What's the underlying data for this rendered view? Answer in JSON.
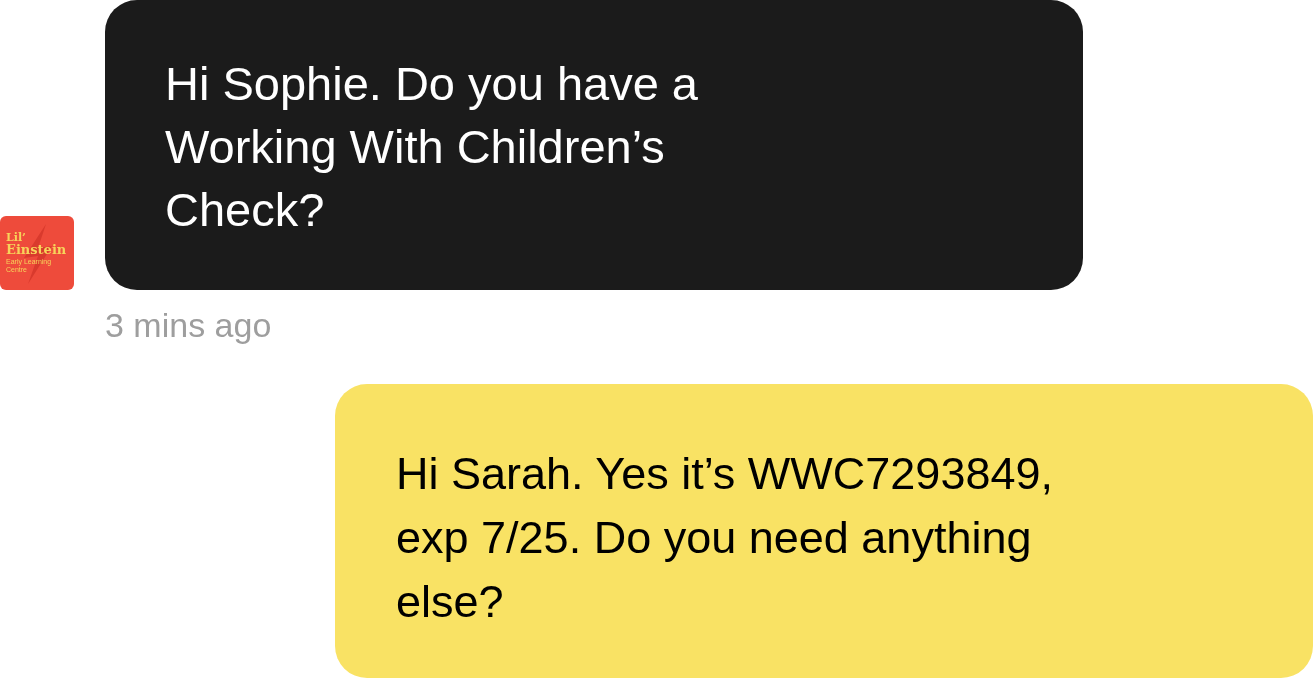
{
  "messages": [
    {
      "kind": "incoming",
      "text": "Hi Sophie. Do you have a Working With Children’s Check?",
      "avatar": {
        "lines": [
          "Lil’",
          "Einstein",
          "Early Learning Centre"
        ]
      },
      "time": "3 mins ago"
    },
    {
      "kind": "outgoing",
      "text": "Hi Sarah. Yes it’s WWC7293849, exp 7/25. Do you need anything else?"
    }
  ]
}
